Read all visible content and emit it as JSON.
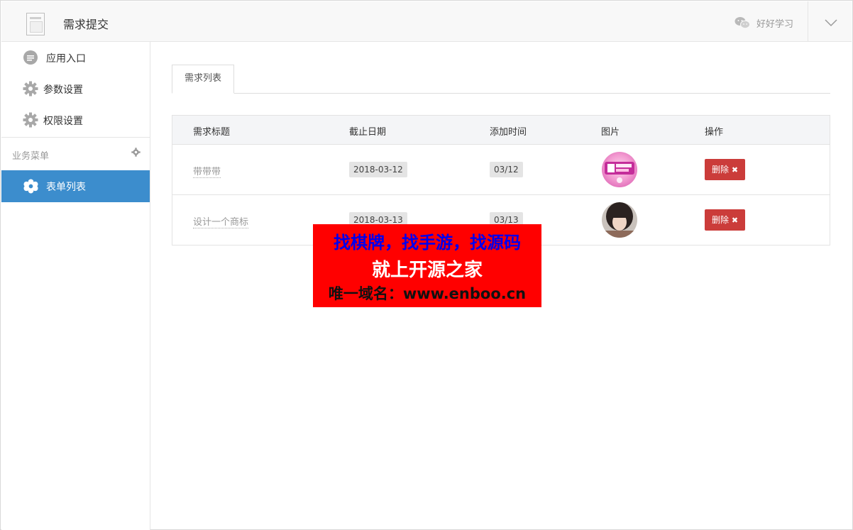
{
  "header": {
    "title": "需求提交",
    "user_name": "好好学习"
  },
  "sidebar": {
    "items": [
      {
        "label": "应用入口",
        "icon": "chat-bubble-icon"
      },
      {
        "label": "参数设置",
        "icon": "gear-icon"
      },
      {
        "label": "权限设置",
        "icon": "gear-icon"
      }
    ],
    "group_label": "业务菜单",
    "active_item": {
      "label": "表单列表",
      "icon": "flower-gear-icon"
    }
  },
  "main": {
    "tab": "需求列表",
    "table": {
      "headers": [
        "需求标题",
        "截止日期",
        "添加时间",
        "图片",
        "操作"
      ],
      "rows": [
        {
          "title": "带带带",
          "deadline": "2018-03-12",
          "added": "03/12",
          "image": "promo-thumbnail",
          "action": "删除"
        },
        {
          "title": "设计一个商标",
          "deadline": "2018-03-13",
          "added": "03/13",
          "image": "portrait-thumbnail",
          "action": "删除"
        }
      ]
    }
  },
  "watermark": {
    "line1": "找棋牌，找手游，找源码",
    "line2": "就上开源之家",
    "line3": "唯一域名：www.enboo.cn"
  },
  "colors": {
    "accent": "#3c8dcd",
    "danger": "#cb3c3a",
    "watermark_bg": "#ff0000",
    "watermark_blue": "#0000ee"
  }
}
